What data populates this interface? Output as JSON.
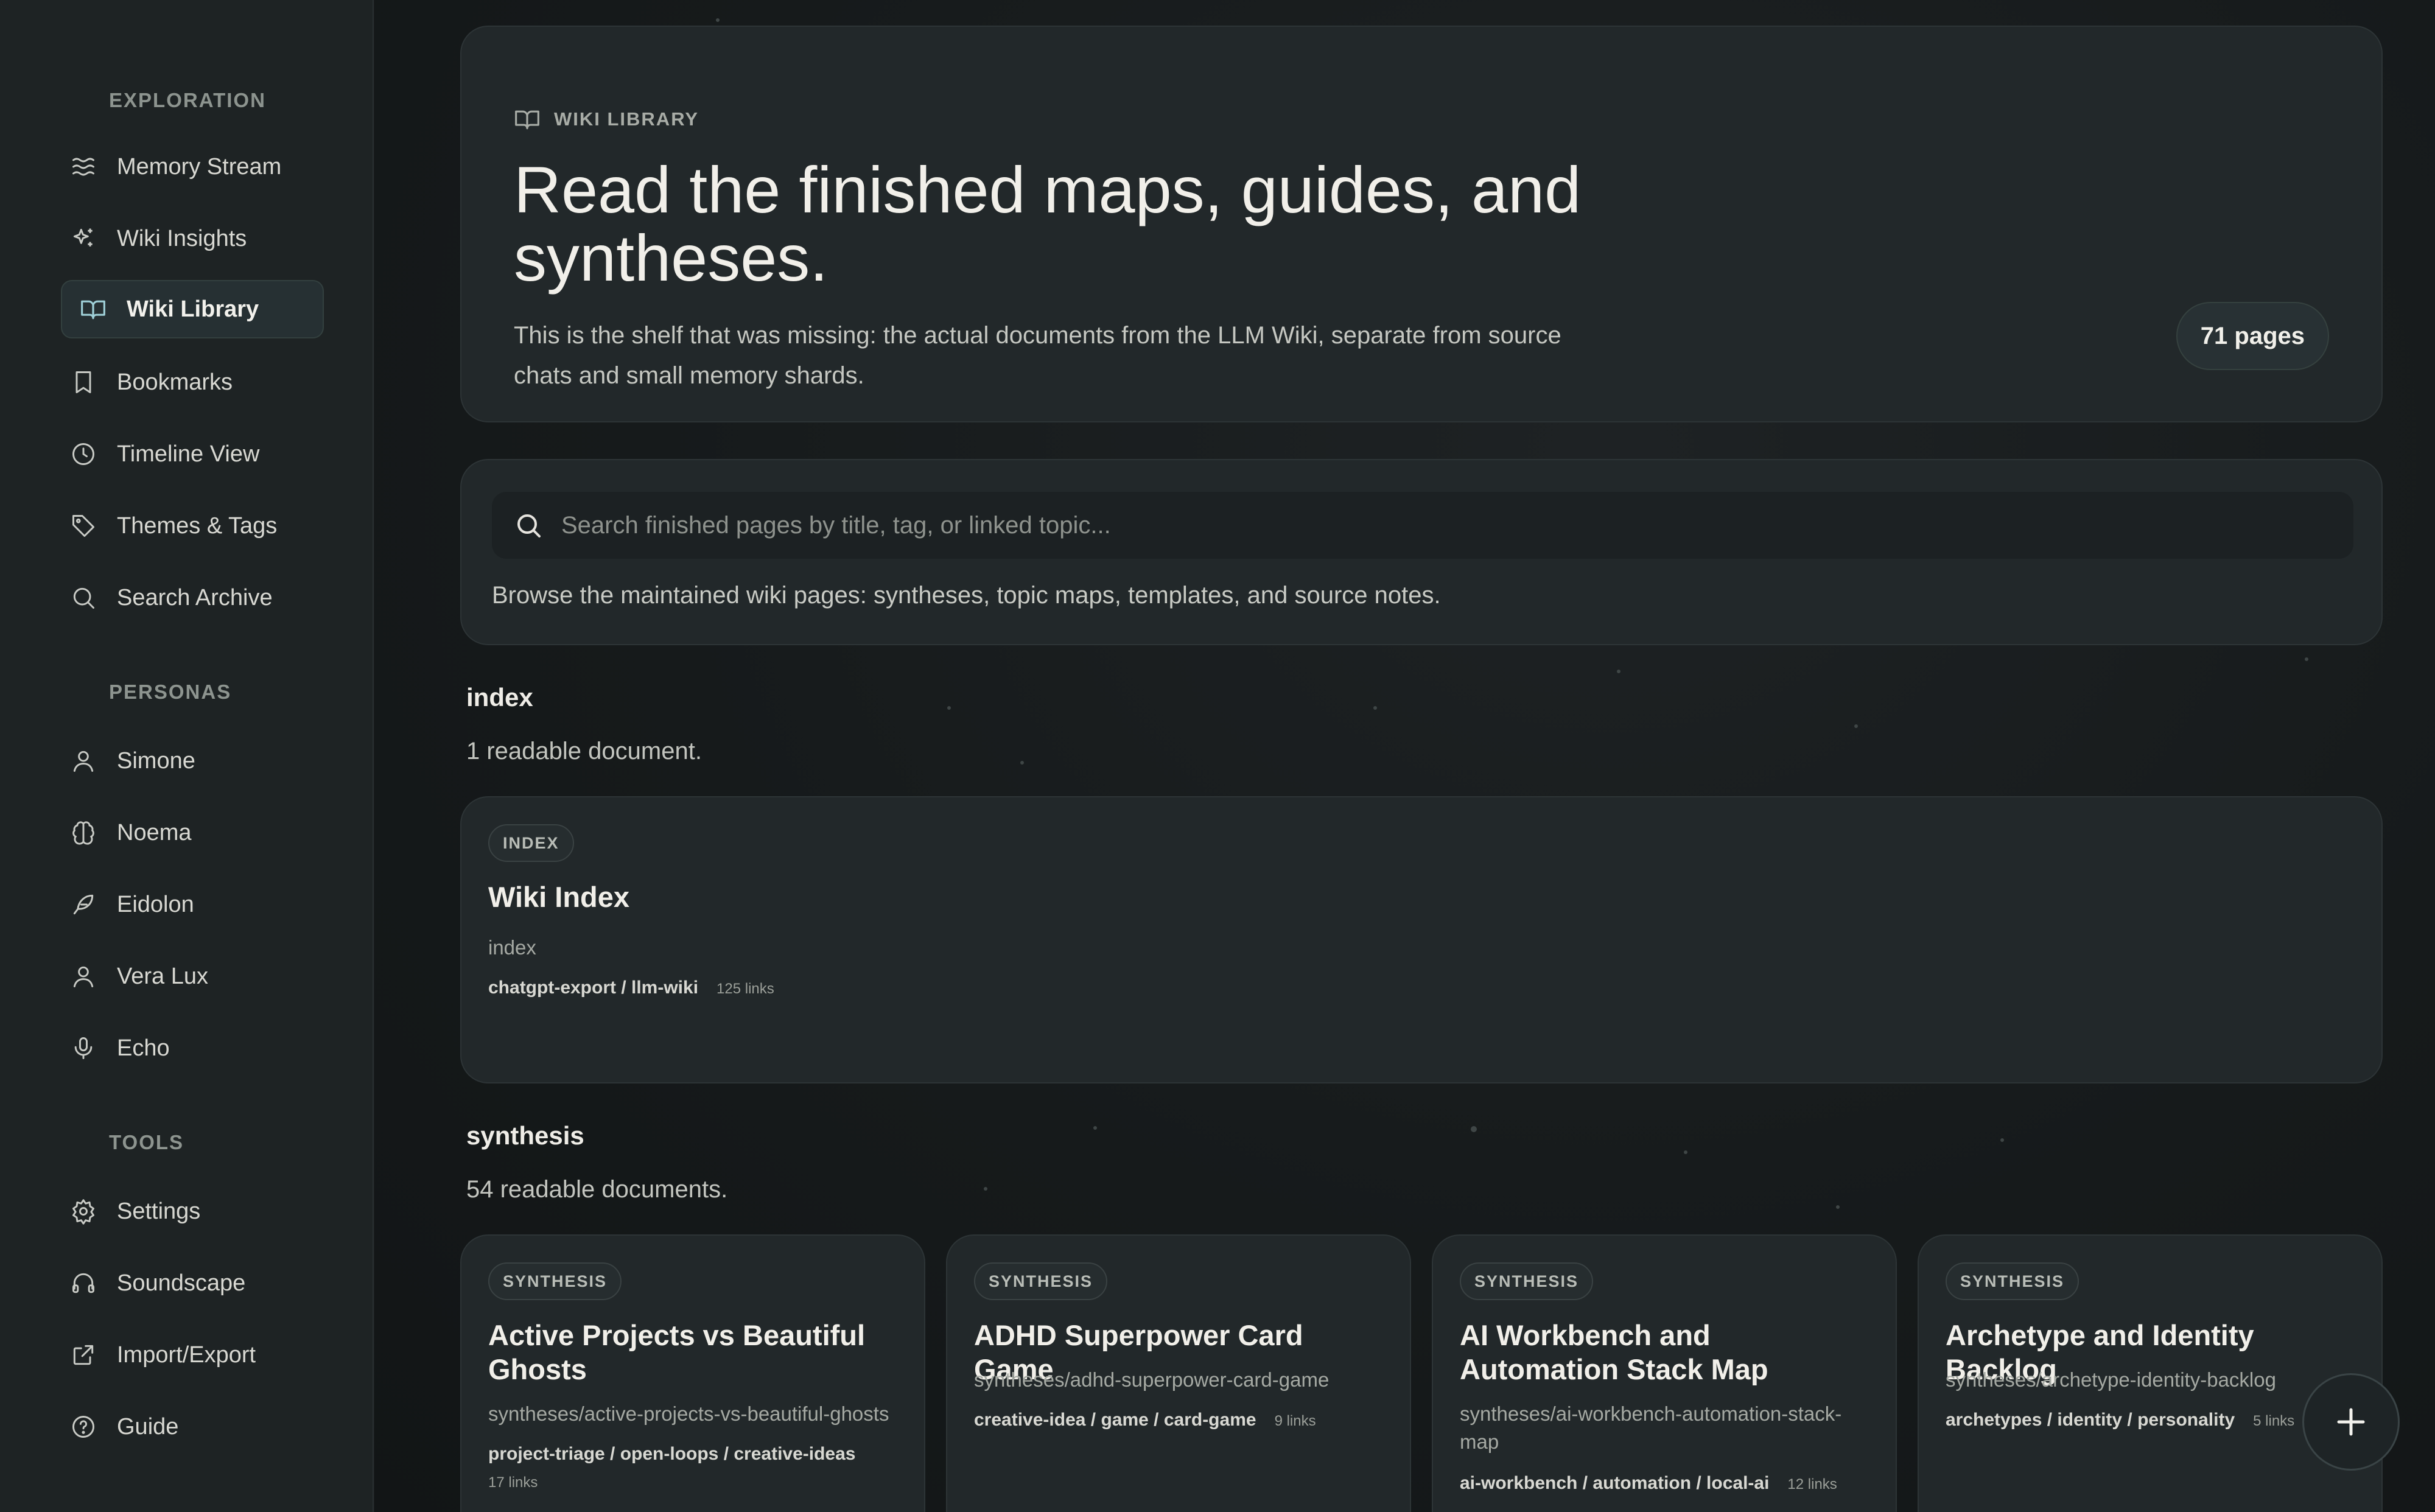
{
  "sidebar": {
    "sections": [
      {
        "label": "EXPLORATION"
      },
      {
        "label": "PERSONAS"
      },
      {
        "label": "TOOLS"
      }
    ],
    "items": [
      {
        "label": "Memory Stream",
        "icon": "waves-icon"
      },
      {
        "label": "Wiki Insights",
        "icon": "sparkles-icon"
      },
      {
        "label": "Wiki Library",
        "icon": "book-open-icon",
        "active": true
      },
      {
        "label": "Bookmarks",
        "icon": "bookmark-icon"
      },
      {
        "label": "Timeline View",
        "icon": "clock-icon"
      },
      {
        "label": "Themes & Tags",
        "icon": "tag-icon"
      },
      {
        "label": "Search Archive",
        "icon": "search-icon"
      },
      {
        "label": "Simone",
        "icon": "user-icon"
      },
      {
        "label": "Noema",
        "icon": "brain-icon"
      },
      {
        "label": "Eidolon",
        "icon": "feather-icon"
      },
      {
        "label": "Vera Lux",
        "icon": "user-icon"
      },
      {
        "label": "Echo",
        "icon": "microphone-icon"
      },
      {
        "label": "Settings",
        "icon": "gear-icon"
      },
      {
        "label": "Soundscape",
        "icon": "headphones-icon"
      },
      {
        "label": "Import/Export",
        "icon": "external-link-icon"
      },
      {
        "label": "Guide",
        "icon": "help-circle-icon"
      }
    ]
  },
  "hero": {
    "eyebrow": "WIKI LIBRARY",
    "title": "Read the finished maps, guides, and syntheses.",
    "description": "This is the shelf that was missing: the actual documents from the LLM Wiki, separate from source chats and small memory shards.",
    "pages_count": "71 pages"
  },
  "search": {
    "placeholder": "Search finished pages by title, tag, or linked topic...",
    "help": "Browse the maintained wiki pages: syntheses, topic maps, templates, and source notes."
  },
  "groups": [
    {
      "title": "index",
      "count": "1 readable document.",
      "docs": [
        {
          "tag": "INDEX",
          "title": "Wiki Index",
          "path": "index",
          "tags": "chatgpt-export / llm-wiki",
          "links": "125 links"
        }
      ]
    },
    {
      "title": "synthesis",
      "count": "54 readable documents.",
      "docs": [
        {
          "tag": "SYNTHESIS",
          "title": "Active Projects vs Beautiful Ghosts",
          "path": "syntheses/active-projects-vs-beautiful-ghosts",
          "tags": "project-triage / open-loops / creative-ideas",
          "links": "17 links"
        },
        {
          "tag": "SYNTHESIS",
          "title": "ADHD Superpower Card Game",
          "path": "syntheses/adhd-superpower-card-game",
          "tags": "creative-idea / game / card-game",
          "links": "9 links"
        },
        {
          "tag": "SYNTHESIS",
          "title": "AI Workbench and Automation Stack Map",
          "path": "syntheses/ai-workbench-automation-stack-map",
          "tags": "ai-workbench / automation / local-ai",
          "links": "12 links"
        },
        {
          "tag": "SYNTHESIS",
          "title": "Archetype and Identity Backlog",
          "path": "syntheses/archetype-identity-backlog",
          "tags": "archetypes / identity / personality",
          "links": "5 links"
        }
      ]
    }
  ],
  "fab": {
    "icon": "plus-icon"
  }
}
